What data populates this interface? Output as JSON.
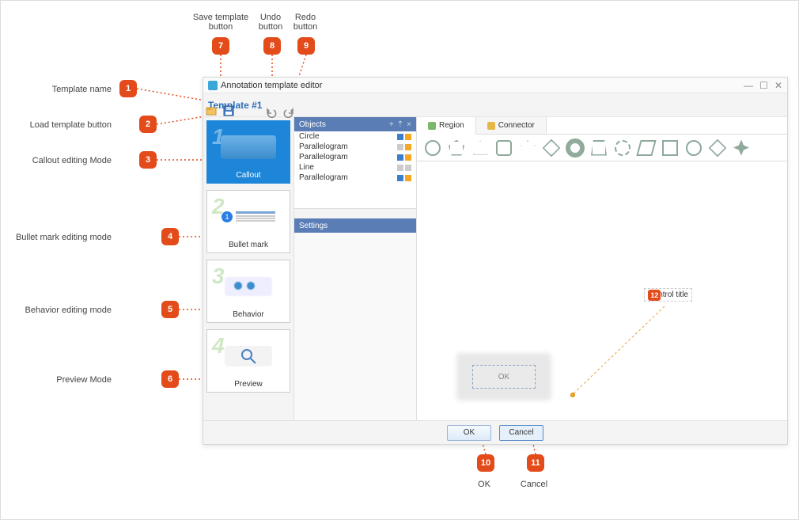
{
  "annotations": {
    "1": "Template name",
    "2": "Load template button",
    "3": "Callout editing Mode",
    "4": "Bullet mark editing mode",
    "5": "Behavior editing mode",
    "6": "Preview Mode",
    "7": "Save template button",
    "8": "Undo button",
    "9": "Redo button",
    "10": "OK",
    "11": "Cancel",
    "12": "Control title"
  },
  "window": {
    "title": "Annotation template editor",
    "template_name": "Template #1"
  },
  "sidebar": {
    "items": [
      {
        "num": "1",
        "label": "Callout"
      },
      {
        "num": "2",
        "label": "Bullet mark"
      },
      {
        "num": "3",
        "label": "Behavior"
      },
      {
        "num": "4",
        "label": "Preview"
      }
    ]
  },
  "panels": {
    "objects_header": "Objects",
    "settings_header": "Settings",
    "objects": [
      "Circle",
      "Parallelogram",
      "Parallelogram",
      "Line",
      "Parallelogram"
    ]
  },
  "tabs": {
    "region": "Region",
    "connector": "Connector"
  },
  "canvas": {
    "control_title": "Control title",
    "preview_ok": "OK"
  },
  "footer": {
    "ok": "OK",
    "cancel": "Cancel"
  }
}
